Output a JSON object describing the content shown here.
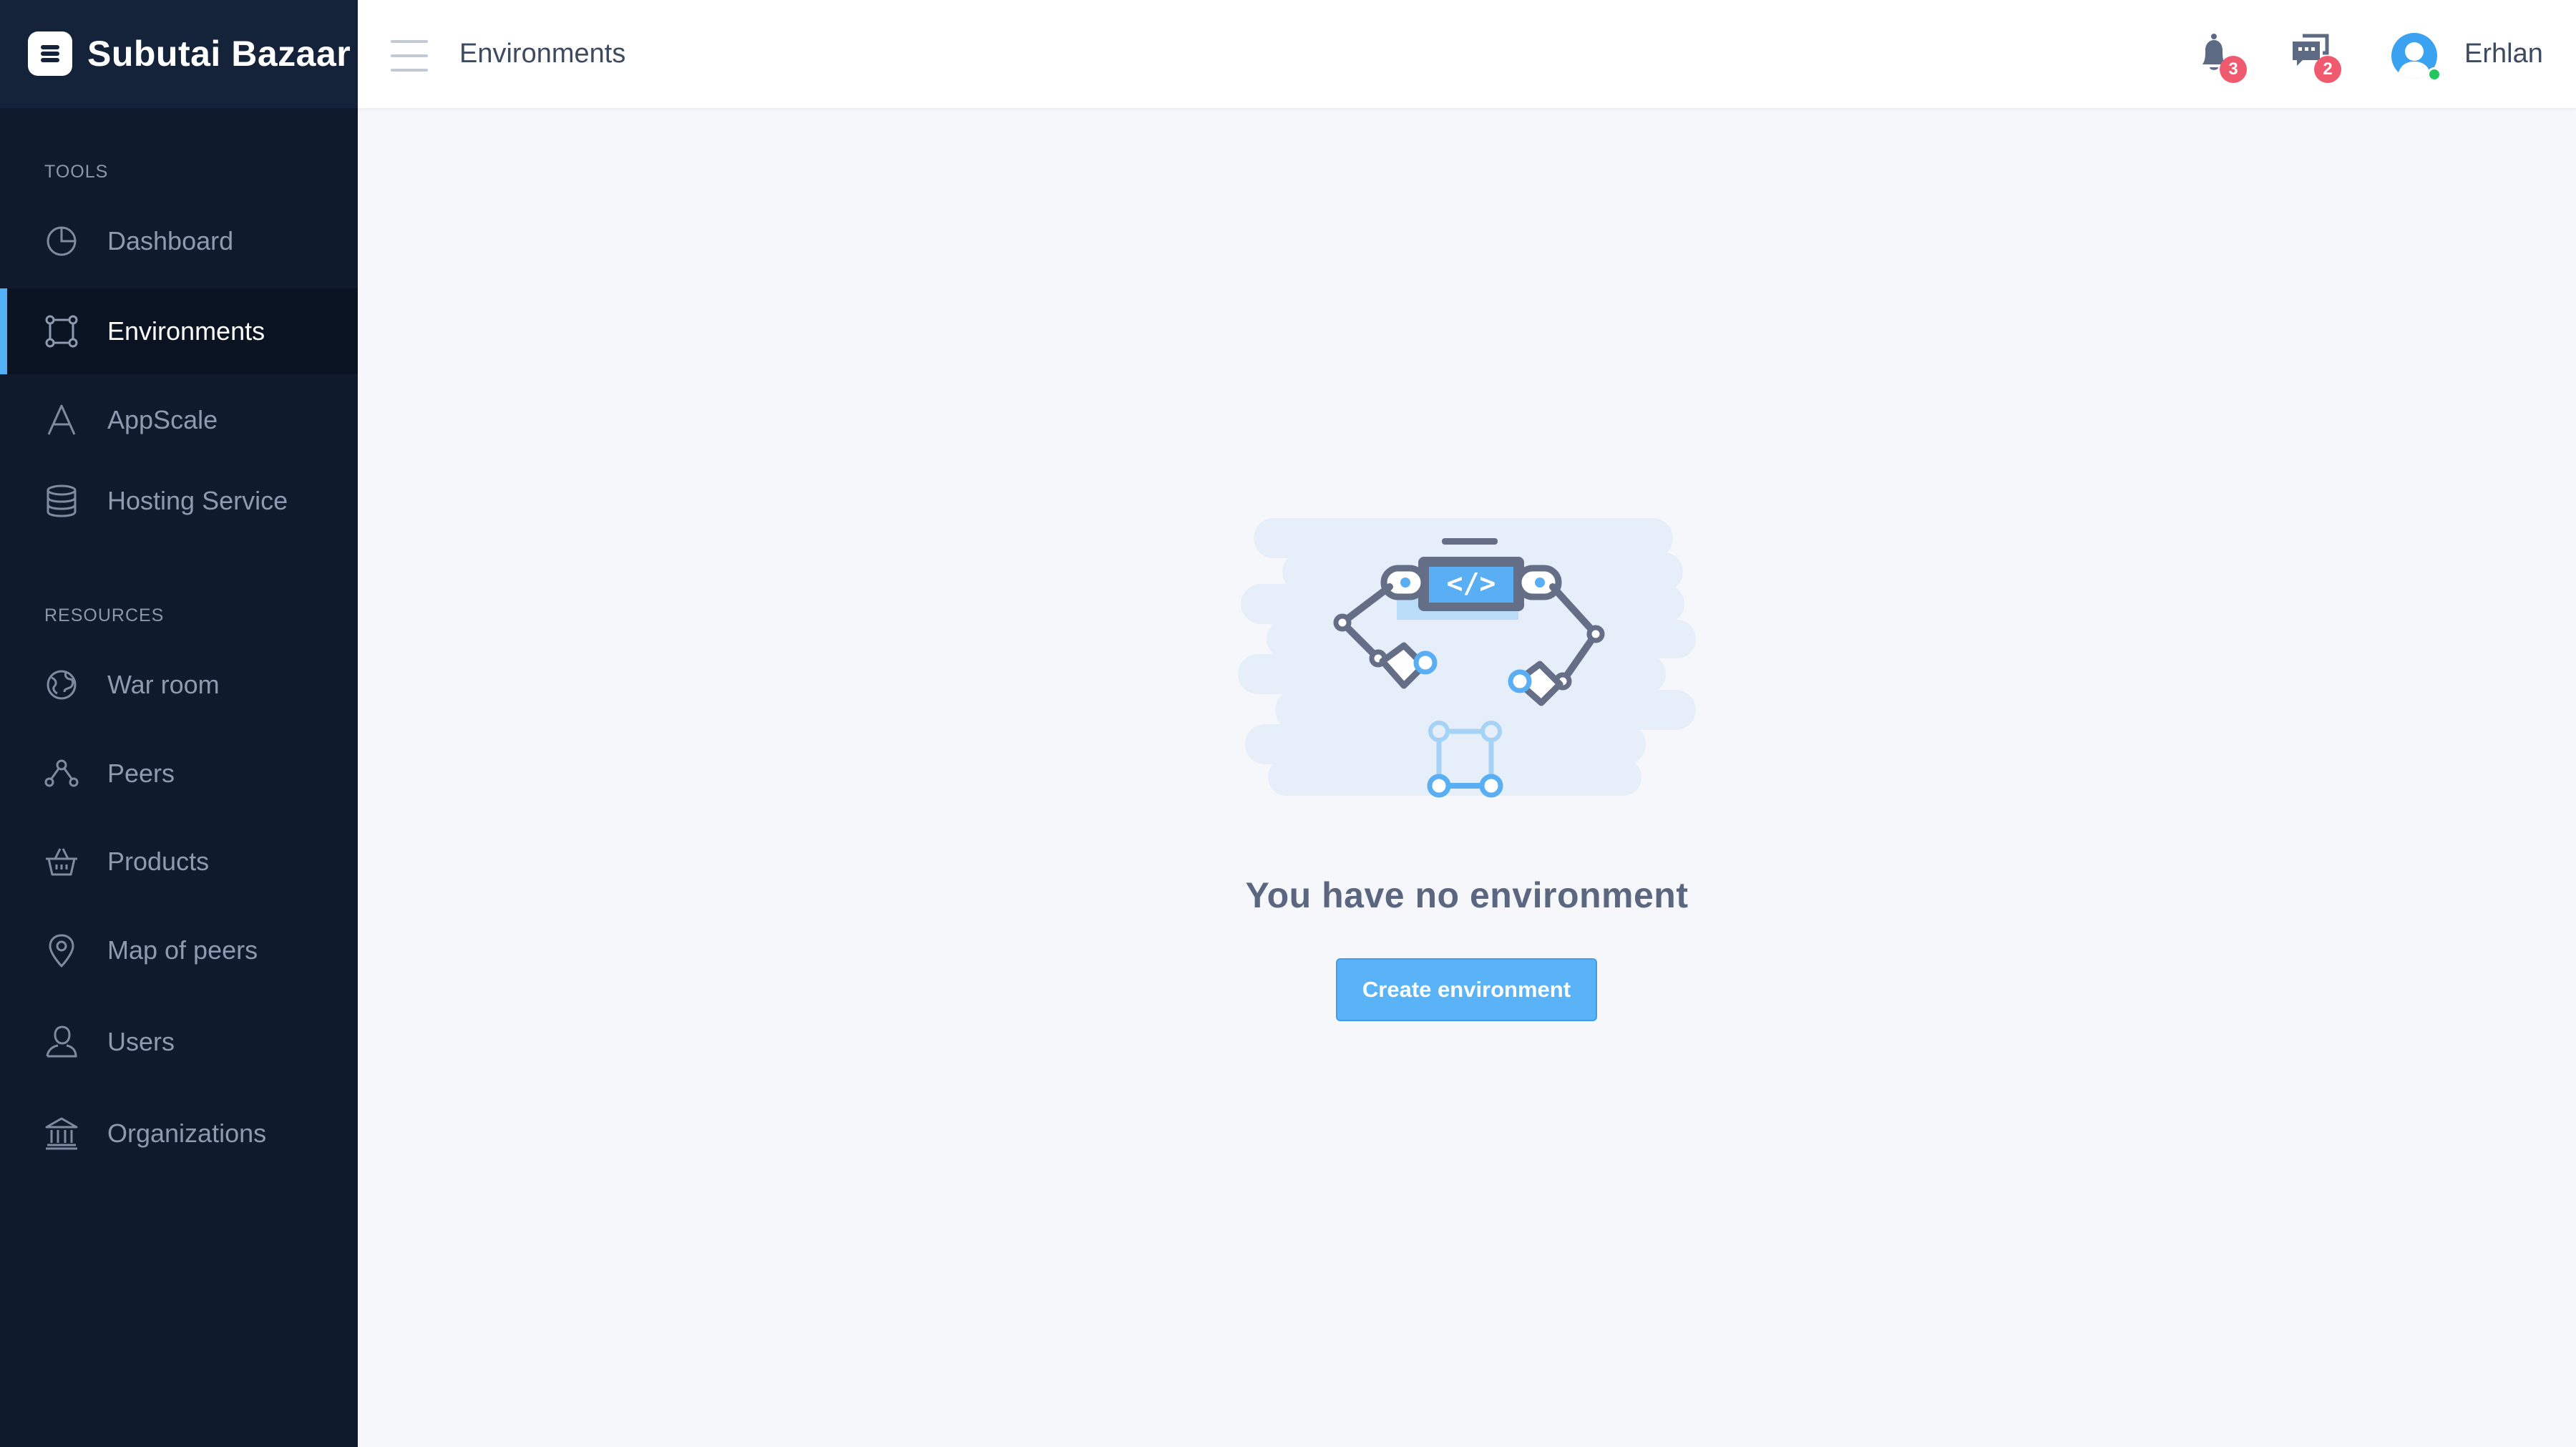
{
  "app": {
    "brand_name": "Subutai Bazaar",
    "accent_color": "#52b0f6"
  },
  "sidebar": {
    "sections": [
      {
        "title": "TOOLS"
      },
      {
        "title": "RESOURCES"
      }
    ],
    "items": [
      {
        "label": "Dashboard",
        "icon": "pie-chart-icon",
        "active": false
      },
      {
        "label": "Environments",
        "icon": "environment-nodes-icon",
        "active": true
      },
      {
        "label": "AppScale",
        "icon": "appscale-a-icon",
        "active": false
      },
      {
        "label": "Hosting Service",
        "icon": "database-stack-icon",
        "active": false
      },
      {
        "label": "War room",
        "icon": "globe-icon",
        "active": false
      },
      {
        "label": "Peers",
        "icon": "peers-network-icon",
        "active": false
      },
      {
        "label": "Products",
        "icon": "basket-icon",
        "active": false
      },
      {
        "label": "Map of peers",
        "icon": "map-pin-icon",
        "active": false
      },
      {
        "label": "Users",
        "icon": "user-icon",
        "active": false
      },
      {
        "label": "Organizations",
        "icon": "bank-building-icon",
        "active": false
      }
    ]
  },
  "header": {
    "title": "Environments",
    "notifications_count": "3",
    "messages_count": "2",
    "user_name": "Erhlan"
  },
  "main": {
    "empty_message": "You have no environment",
    "create_button_label": "Create environment"
  }
}
